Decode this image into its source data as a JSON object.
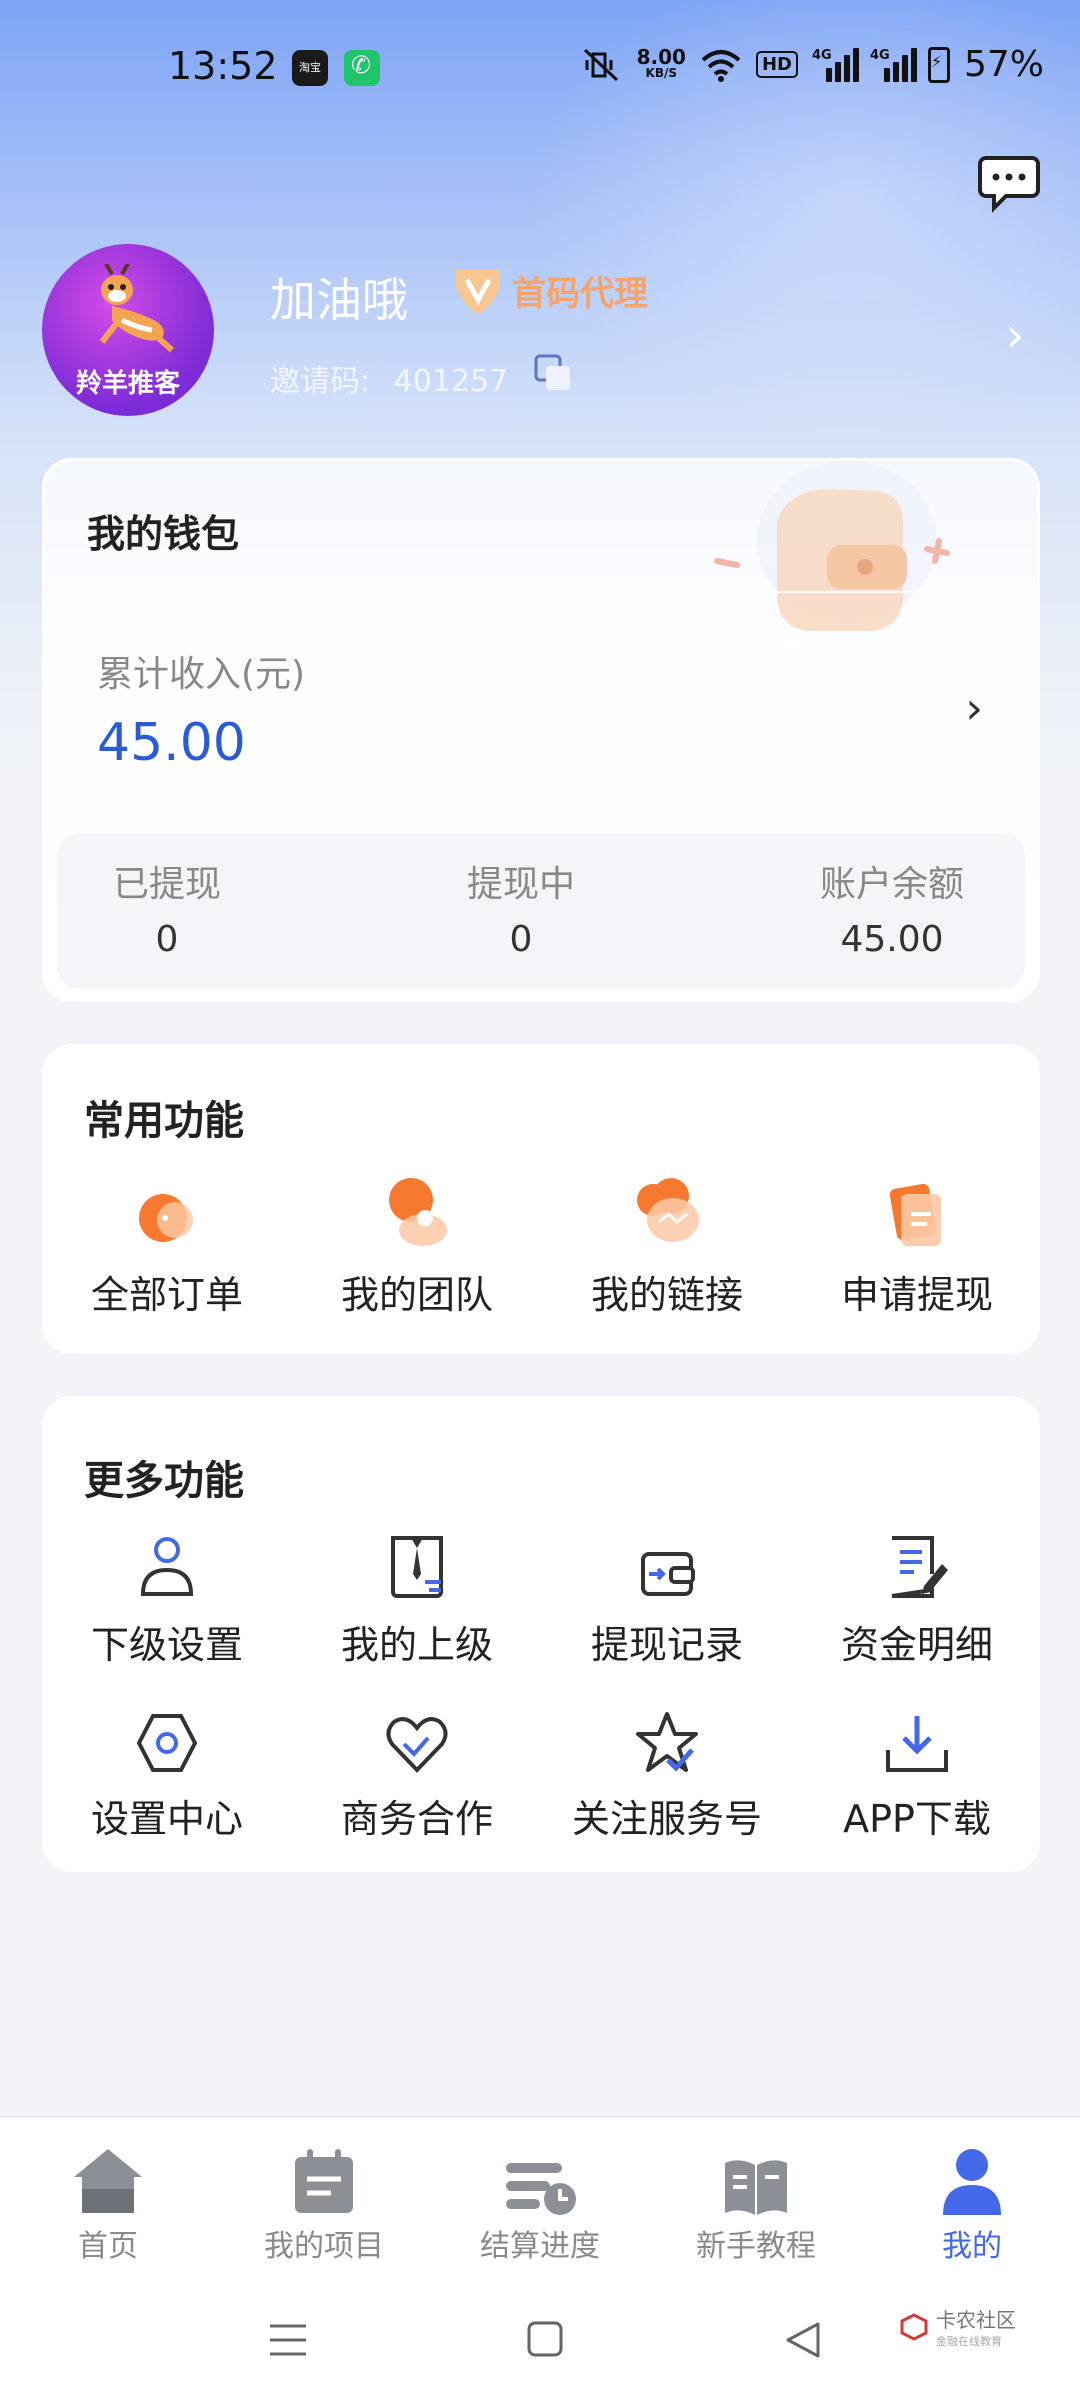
{
  "status_bar": {
    "time": "13:52",
    "net_speed_value": "8.00",
    "net_speed_unit": "KB/S",
    "hd": "HD",
    "sim1": "4G",
    "sim2": "4G",
    "battery": "57%",
    "notif_badge": "淘宝"
  },
  "profile": {
    "avatar_text": "羚羊推客",
    "username": "加油哦",
    "badge": "首码代理",
    "invite_label": "邀请码:",
    "invite_code": "401257"
  },
  "wallet": {
    "title": "我的钱包",
    "total_label": "累计收入(元)",
    "total_value": "45.00",
    "stats": [
      {
        "label": "已提现",
        "value": "0"
      },
      {
        "label": "提现中",
        "value": "0"
      },
      {
        "label": "账户余额",
        "value": "45.00"
      }
    ]
  },
  "common_functions": {
    "title": "常用功能",
    "items": [
      {
        "label": "全部订单",
        "icon": "orders-icon"
      },
      {
        "label": "我的团队",
        "icon": "team-icon"
      },
      {
        "label": "我的链接",
        "icon": "link-icon"
      },
      {
        "label": "申请提现",
        "icon": "withdraw-icon"
      }
    ]
  },
  "more_functions": {
    "title": "更多功能",
    "items": [
      {
        "label": "下级设置",
        "icon": "user-icon"
      },
      {
        "label": "我的上级",
        "icon": "superior-icon"
      },
      {
        "label": "提现记录",
        "icon": "wallet-icon"
      },
      {
        "label": "资金明细",
        "icon": "document-edit-icon"
      },
      {
        "label": "设置中心",
        "icon": "settings-hexagon-icon"
      },
      {
        "label": "商务合作",
        "icon": "handshake-heart-icon"
      },
      {
        "label": "关注服务号",
        "icon": "star-check-icon"
      },
      {
        "label": "APP下载",
        "icon": "download-icon"
      }
    ]
  },
  "bottom_nav": {
    "items": [
      {
        "label": "首页",
        "icon": "home-icon"
      },
      {
        "label": "我的项目",
        "icon": "project-icon"
      },
      {
        "label": "结算进度",
        "icon": "progress-icon"
      },
      {
        "label": "新手教程",
        "icon": "book-icon"
      },
      {
        "label": "我的",
        "icon": "profile-icon"
      }
    ],
    "active_index": 4
  },
  "watermark": {
    "main": "卡农社区",
    "sub": "金融在线教育"
  },
  "colors": {
    "accent": "#4469e8",
    "value_blue": "#2a5bd7",
    "badge_orange": "#f4a36a",
    "icon_orange": "#f7782f"
  }
}
